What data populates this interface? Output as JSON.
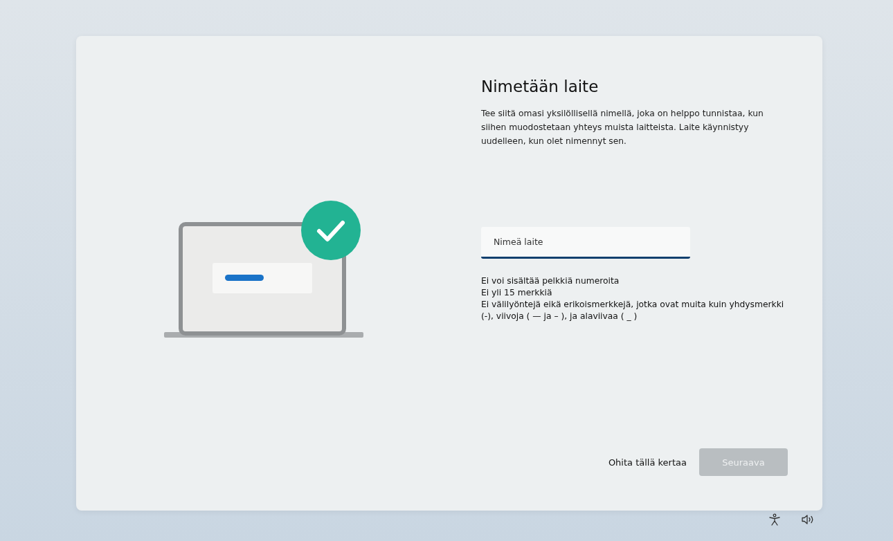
{
  "dialog": {
    "title": "Nimetään laite",
    "description": "Tee siitä omasi yksilöllisellä nimellä, joka on helppo tunnistaa, kun siihen muodostetaan yhteys muista laitteista. Laite käynnistyy uudelleen, kun olet nimennyt sen.",
    "name_field": {
      "placeholder": "Nimeä laite"
    },
    "rules": [
      "Ei voi sisältää pelkkiä numeroita",
      "Ei yli 15 merkkiä",
      "Ei välilyöntejä eikä erikoismerkkejä, jotka ovat muita kuin yhdysmerkki (-), viivoja ( — ja – ), ja alaviivaa ( _ )"
    ],
    "skip_button": {
      "label": "Ohita tällä kertaa"
    },
    "next_button": {
      "label": "Seuraava",
      "disabled": true
    }
  }
}
